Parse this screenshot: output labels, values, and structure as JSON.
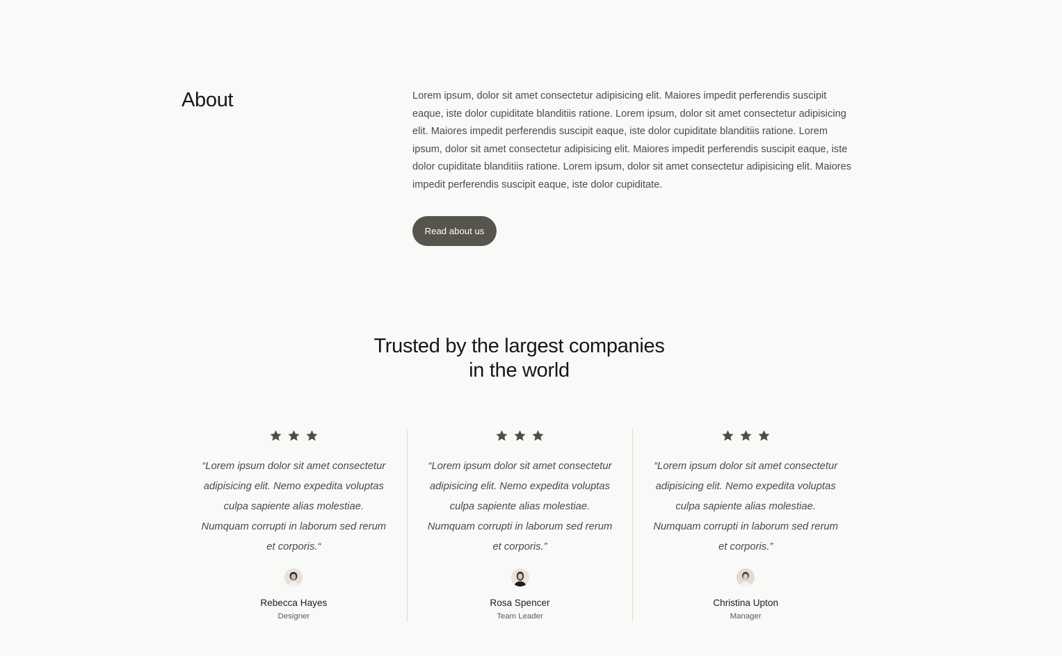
{
  "about": {
    "title": "About",
    "body": "Lorem ipsum, dolor sit amet consectetur adipisicing elit. Maiores impedit perferendis suscipit eaque, iste dolor cupiditate blanditiis ratione. Lorem ipsum, dolor sit amet consectetur adipisicing elit. Maiores impedit perferendis suscipit eaque, iste dolor cupiditate blanditiis ratione. Lorem ipsum, dolor sit amet consectetur adipisicing elit. Maiores impedit perferendis suscipit eaque, iste dolor cupiditate blanditiis ratione. Lorem ipsum, dolor sit amet consectetur adipisicing elit. Maiores impedit perferendis suscipit eaque, iste dolor cupiditate.",
    "button_label": "Read about us"
  },
  "trusted": {
    "title_line1": "Trusted by the largest companies",
    "title_line2": "in the world"
  },
  "testimonials": [
    {
      "stars": 3,
      "quote": "“Lorem ipsum dolor sit amet consectetur adipisicing elit. Nemo expedita voluptas culpa sapiente alias molestiae. Numquam corrupti in laborum sed rerum et corporis.“",
      "name": "Rebecca Hayes",
      "role": "Designer",
      "avatar_icon": "avatar-icon"
    },
    {
      "stars": 3,
      "quote": "“Lorem ipsum dolor sit amet consectetur adipisicing elit. Nemo expedita voluptas culpa sapiente alias molestiae. Numquam corrupti in laborum sed rerum et corporis.”",
      "name": "Rosa Spencer",
      "role": "Team Leader",
      "avatar_icon": "avatar-icon"
    },
    {
      "stars": 3,
      "quote": "“Lorem ipsum dolor sit amet consectetur adipisicing elit. Nemo expedita voluptas culpa sapiente alias molestiae. Numquam corrupti in laborum sed rerum et corporis.”",
      "name": "Christina Upton",
      "role": "Manager",
      "avatar_icon": "avatar-icon"
    }
  ],
  "colors": {
    "background": "#f9f9f7",
    "button": "#57534d",
    "star": "#4f4d4a",
    "divider": "#dcdcd8"
  }
}
